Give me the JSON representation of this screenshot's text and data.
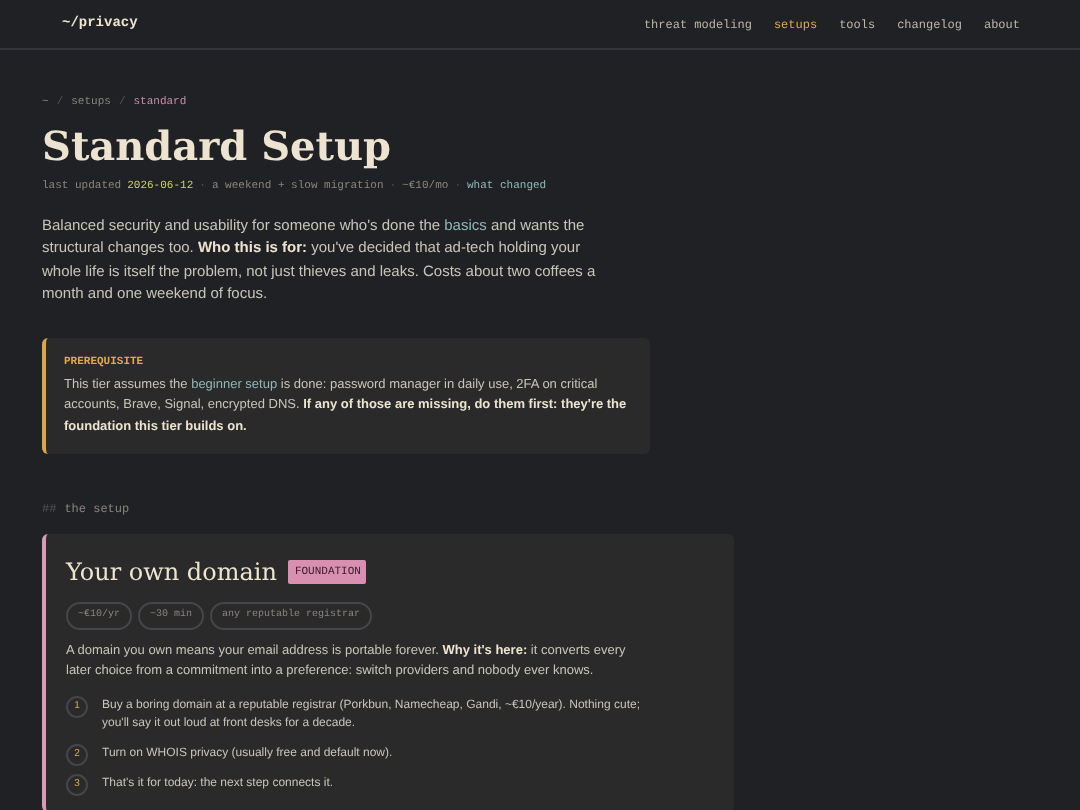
{
  "header": {
    "logo": "~/privacy",
    "nav": [
      {
        "label": "threat modeling",
        "selected": false
      },
      {
        "label": "setups",
        "selected": true
      },
      {
        "label": "tools",
        "selected": false
      },
      {
        "label": "changelog",
        "selected": false
      },
      {
        "label": "about",
        "selected": false
      }
    ]
  },
  "breadcrumb": [
    {
      "kind": "link",
      "text": "~"
    },
    {
      "kind": "sep",
      "text": "/"
    },
    {
      "kind": "link",
      "text": "setups"
    },
    {
      "kind": "sep",
      "text": "/"
    },
    {
      "kind": "current",
      "text": "standard"
    }
  ],
  "title": "Standard Setup",
  "meta": [
    {
      "kind": "text",
      "text": "last updated"
    },
    {
      "kind": "date",
      "text": "2026-06-12"
    },
    {
      "kind": "sep",
      "text": "·"
    },
    {
      "kind": "text",
      "text": "a weekend + slow migration"
    },
    {
      "kind": "sep",
      "text": "·"
    },
    {
      "kind": "text",
      "text": "~€10/mo"
    },
    {
      "kind": "sep",
      "text": "·"
    },
    {
      "kind": "link",
      "text": "what changed"
    }
  ],
  "intro": [
    {
      "kind": "text",
      "text": "Balanced security and usability for someone who's done the "
    },
    {
      "kind": "link",
      "text": "basics"
    },
    {
      "kind": "text",
      "text": " and wants the structural changes too. **Who this is for:** you've decided that ad-tech holding your whole life is itself the problem, not just thieves and leaks. Costs about two coffees a month and one weekend of focus."
    }
  ],
  "prerequisite": {
    "label": "PREREQUISITE",
    "body": [
      {
        "kind": "text",
        "text": "This tier assumes the "
      },
      {
        "kind": "link",
        "text": "beginner setup"
      },
      {
        "kind": "text",
        "text": " is done: password manager in daily use, 2FA on critical accounts, Brave, Signal, encrypted DNS. **If any of those are missing, do them first: they're the foundation this tier builds on.**"
      }
    ]
  },
  "section_heading": {
    "marker": "##",
    "text": "the setup"
  },
  "card": {
    "title": "Your own domain",
    "badge": "FOUNDATION",
    "tags": [
      "~€10/yr",
      "~30 min",
      "any reputable registrar"
    ],
    "body": [
      {
        "kind": "text",
        "text": "A domain you own means your email address is portable forever. **Why it's here:** it converts every later choice from a commitment into a preference: switch providers and nobody ever knows."
      }
    ],
    "steps": [
      {
        "number": "1",
        "text": "Buy a boring domain at a reputable registrar (Porkbun, Namecheap, Gandi, ~€10/year). Nothing cute; you'll say it out loud at front desks for a decade."
      },
      {
        "number": "2",
        "text": "Turn on WHOIS privacy (usually free and default now)."
      },
      {
        "number": "3",
        "text": "That's it for today: the next step connects it."
      }
    ]
  }
}
